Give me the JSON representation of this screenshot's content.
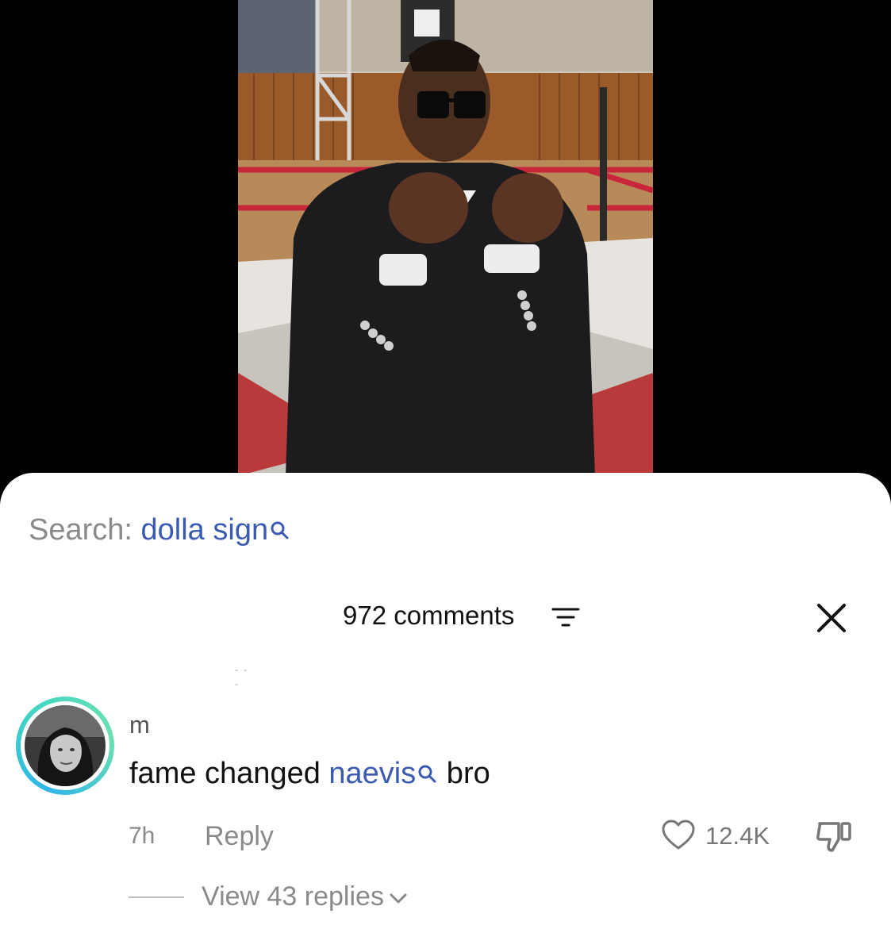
{
  "search": {
    "prefix": "Search:",
    "term": "dolla sign"
  },
  "comments_header": {
    "count_label": "972 comments"
  },
  "comment": {
    "username": "m",
    "text_before": "fame changed ",
    "mention": "naevis",
    "text_after": " bro",
    "time": "7h",
    "reply_label": "Reply",
    "like_count": "12.4K",
    "view_replies_label": "View 43 replies"
  },
  "icons": {
    "search_glyph": "search-icon",
    "filter": "filter-icon",
    "close": "close-icon",
    "like": "heart-icon",
    "dislike": "thumbs-down-icon",
    "expand": "chevron-down-icon"
  },
  "colors": {
    "link_blue": "#3a5bb0",
    "muted_text": "#8a8a8a",
    "avatar_ring_start": "#2fb5e8",
    "avatar_ring_end": "#6ce0b2"
  }
}
